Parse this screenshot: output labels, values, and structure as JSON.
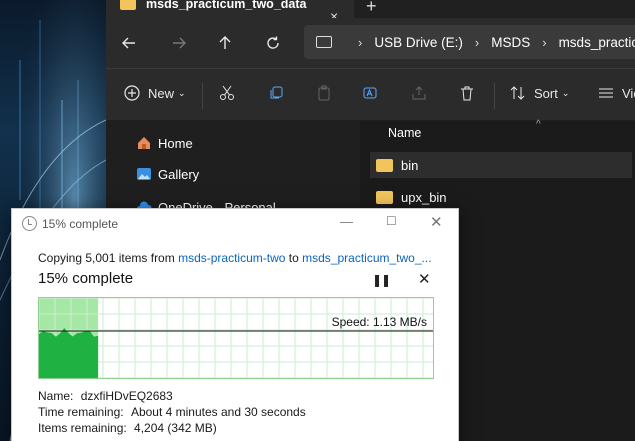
{
  "tab": {
    "title": "msds_practicum_two_data",
    "close": "×",
    "new": "+"
  },
  "address": {
    "segments": [
      "USB Drive (E:)",
      "MSDS",
      "msds_practic"
    ],
    "separator": "›"
  },
  "commands": {
    "new_label": "New",
    "sort_label": "Sort",
    "view_label": "Vie"
  },
  "sidebar": {
    "items": [
      {
        "label": "Home"
      },
      {
        "label": "Gallery"
      },
      {
        "label": "OneDrive - Personal"
      }
    ]
  },
  "files": {
    "column_name": "Name",
    "rows": [
      {
        "name": "bin"
      },
      {
        "name": "upx_bin"
      }
    ]
  },
  "dialog": {
    "title": "15% complete",
    "copying_prefix": "Copying 5,001 items from",
    "source": "msds-practicum-two",
    "to_word": "to",
    "destination": "msds_practicum_two_...",
    "percent_text": "15% complete",
    "progress": 0.15,
    "speed_text": "Speed: 1.13 MB/s",
    "name_label": "Name:",
    "name_value": "dzxfiHDvEQ2683",
    "time_label": "Time remaining:",
    "time_value": "About 4 minutes and 30 seconds",
    "items_label": "Items remaining:",
    "items_value": "4,204 (342 MB)"
  },
  "colors": {
    "progress_fill": "#1fb141",
    "progress_bg": "#a5e7a5",
    "link": "#0a64c2",
    "folder": "#f2c55c"
  }
}
